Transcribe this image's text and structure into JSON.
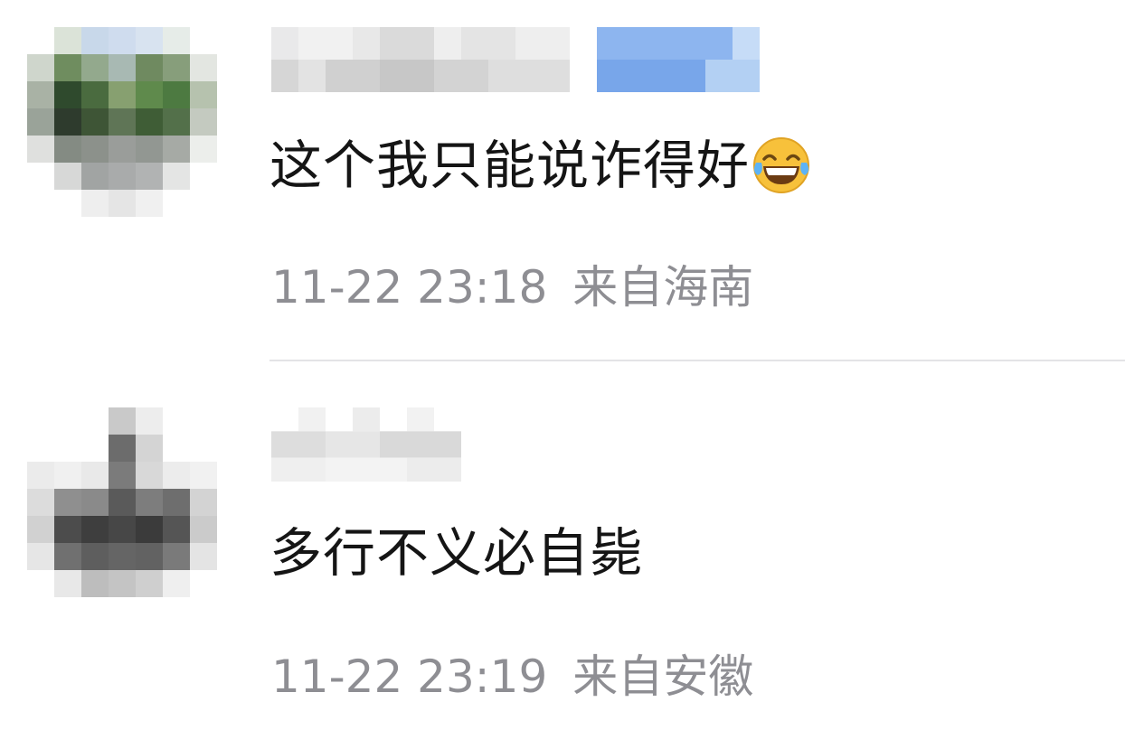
{
  "comments": [
    {
      "text": "这个我只能说诈得好",
      "emoji": "joy-tears-emoji",
      "time": "11-22 23:18",
      "location": "来自海南"
    },
    {
      "text": "多行不义必自毙",
      "time": "11-22 23:19",
      "location": "来自安徽"
    }
  ],
  "colors": {
    "text": "#151515",
    "meta": "#8e8e93",
    "divider": "#e3e3e6",
    "emoji_face": "#f7c13b"
  }
}
